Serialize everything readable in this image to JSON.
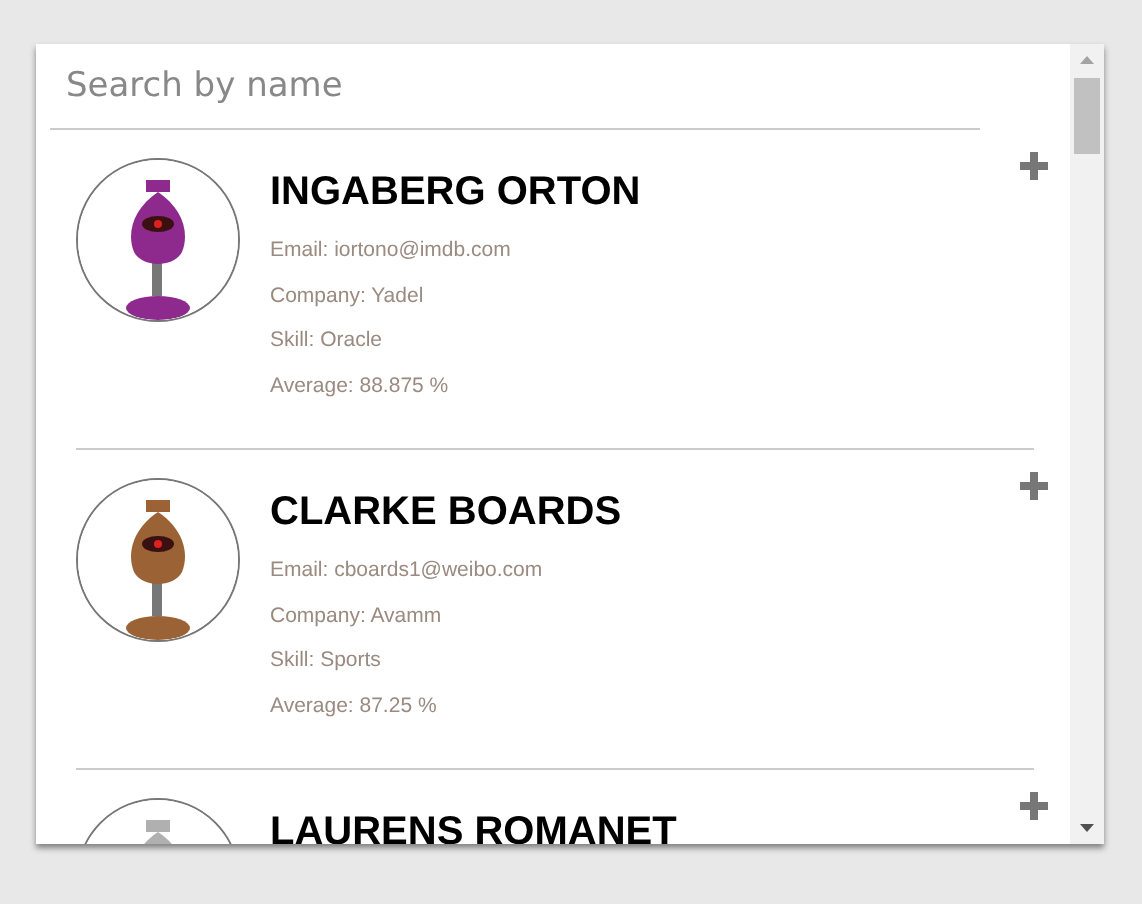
{
  "search": {
    "placeholder": "Search by name"
  },
  "people": [
    {
      "name": "INGABERG ORTON",
      "email": "Email: iortono@imdb.com",
      "company": "Company: Yadel",
      "skill": "Skill: Oracle",
      "average": "Average: 88.875 %"
    },
    {
      "name": "CLARKE BOARDS",
      "email": "Email: cboards1@weibo.com",
      "company": "Company: Avamm",
      "skill": "Skill: Sports",
      "average": "Average: 87.25 %"
    },
    {
      "name": "LAURENS ROMANET"
    }
  ]
}
